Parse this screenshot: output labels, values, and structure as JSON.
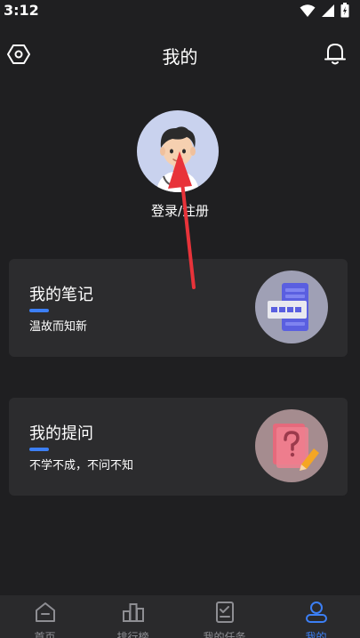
{
  "status": {
    "time": "3:12"
  },
  "header": {
    "title": "我的"
  },
  "profile": {
    "login_label": "登录/注册"
  },
  "cards": [
    {
      "title": "我的笔记",
      "subtitle": "温故而知新"
    },
    {
      "title": "我的提问",
      "subtitle": "不学不成，不问不知"
    }
  ],
  "tabs": [
    {
      "label": "首页",
      "icon": "home-icon",
      "active": false
    },
    {
      "label": "排行榜",
      "icon": "ranking-icon",
      "active": false
    },
    {
      "label": "我的任务",
      "icon": "tasks-icon",
      "active": false
    },
    {
      "label": "我的",
      "icon": "profile-icon",
      "active": true
    }
  ],
  "colors": {
    "background": "#1f1f21",
    "card": "#2c2c2e",
    "accent": "#3c7ff5",
    "annotation_arrow": "#e8333a"
  }
}
